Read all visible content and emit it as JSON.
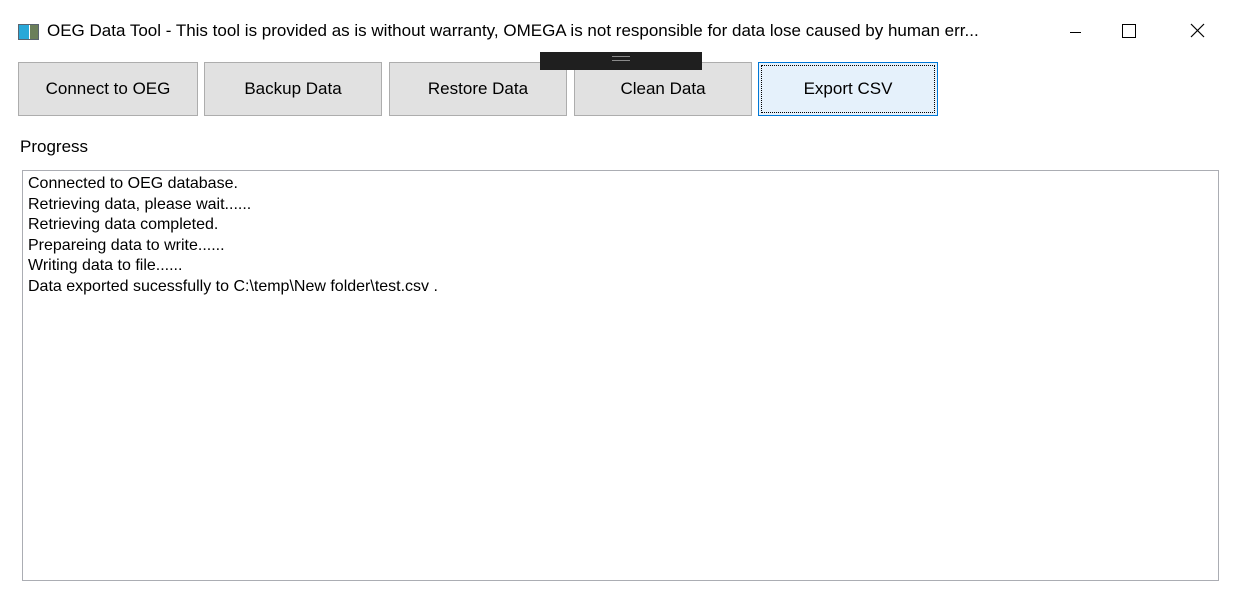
{
  "window": {
    "title": "OEG Data Tool - This tool is provided as is without warranty, OMEGA is not responsible for data lose caused by human err...",
    "controls": {
      "minimize_icon": "minimize-icon",
      "maximize_icon": "maximize-icon",
      "close_icon": "close-icon"
    }
  },
  "toolbar": {
    "buttons": [
      {
        "label": "Connect to OEG"
      },
      {
        "label": "Backup Data"
      },
      {
        "label": "Restore Data"
      },
      {
        "label": "Clean Data"
      },
      {
        "label": "Export CSV"
      }
    ],
    "focused_button": "Export CSV"
  },
  "progress": {
    "label": "Progress",
    "lines": [
      "Connected to OEG database.",
      "Retrieving data, please wait......",
      "Retrieving data completed.",
      "Prepareing data to write......",
      "Writing data to file......",
      "Data exported sucessfully to C:\\temp\\New folder\\test.csv ."
    ]
  },
  "colors": {
    "button_bg": "#e1e1e1",
    "button_border": "#adadad",
    "focused_button_border": "#0078d7",
    "textbox_border": "#abadb3",
    "icon_blue": "#29a8d8",
    "icon_green": "#6b7f5a"
  }
}
